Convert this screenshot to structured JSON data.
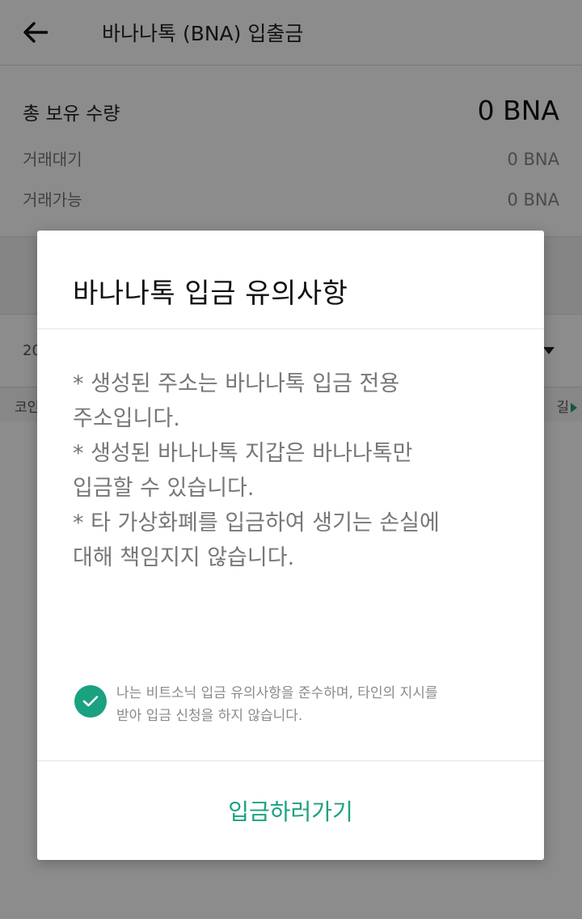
{
  "header": {
    "title": "바나나톡 (BNA) 입출금",
    "back_icon": "arrow-left-icon"
  },
  "holdings": {
    "total_label": "총 보유 수량",
    "total_value": "0 BNA",
    "pending_label": "거래대기",
    "pending_value": "0 BNA",
    "available_label": "거래가능",
    "available_value": "0 BNA"
  },
  "background": {
    "date_fragment": "20",
    "column_left_fragment": "코인",
    "column_right_fragment": "길"
  },
  "modal": {
    "title": "바나나톡 입금 유의사항",
    "notice_lines": [
      "* 생성된 주소는 바나나톡 입금 전용",
      "주소입니다.",
      "* 생성된 바나나톡 지갑은 바나나톡만",
      "입금할 수 있습니다.",
      "* 타 가상화폐를 입금하여 생기는 손실에",
      "대해 책임지지 않습니다."
    ],
    "consent_checked": true,
    "consent_line1": "나는 비트소닉 입금 유의사항을 준수하며, 타인의 지시를",
    "consent_line2": "받아 입금 신청을 하지 않습니다.",
    "action_label": "입금하러가기"
  },
  "colors": {
    "accent": "#1aa180",
    "overlay": "rgba(0,0,0,0.45)"
  }
}
